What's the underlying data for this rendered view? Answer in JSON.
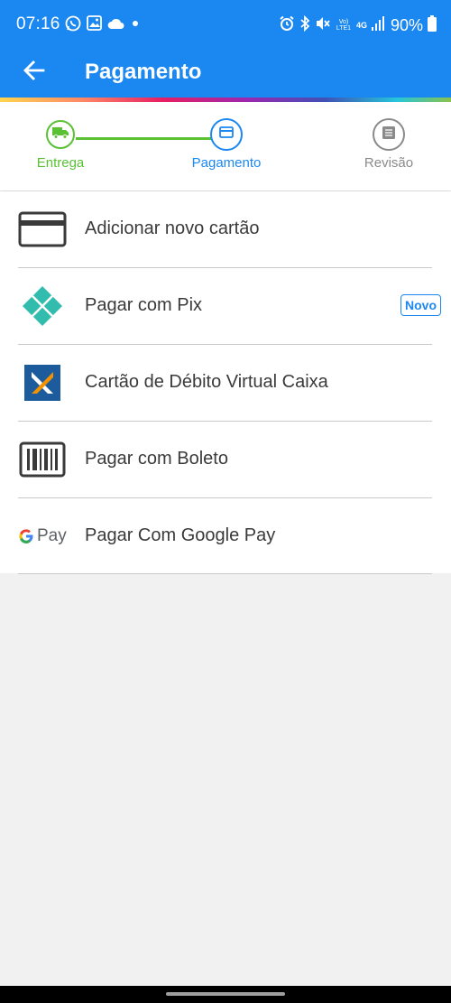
{
  "status_bar": {
    "time": "07:16",
    "battery": "90%",
    "network": "4G",
    "volte": "Vo) LTE1",
    "icons_left": [
      "whatsapp-icon",
      "gallery-icon",
      "cloud-icon",
      "dot-icon"
    ],
    "icons_right": [
      "alarm-icon",
      "bluetooth-icon",
      "mute-icon",
      "volte-icon",
      "network-4g-icon",
      "signal-icon",
      "battery-icon"
    ]
  },
  "header": {
    "title": "Pagamento",
    "back_icon": "arrow-left-icon"
  },
  "stepper": {
    "steps": [
      {
        "label": "Entrega",
        "icon": "truck-icon",
        "state": "completed"
      },
      {
        "label": "Pagamento",
        "icon": "card-icon",
        "state": "current"
      },
      {
        "label": "Revisão",
        "icon": "document-icon",
        "state": "pending"
      }
    ]
  },
  "payment_options": [
    {
      "label": "Adicionar novo cartão",
      "icon": "credit-card-icon"
    },
    {
      "label": "Pagar com Pix",
      "icon": "pix-logo",
      "badge": "Novo"
    },
    {
      "label": "Cartão de Débito Virtual Caixa",
      "icon": "caixa-logo"
    },
    {
      "label": "Pagar com Boleto",
      "icon": "barcode-icon"
    },
    {
      "label": "Pagar Com Google Pay",
      "icon": "google-pay-logo",
      "logo_text": "Pay"
    }
  ],
  "colors": {
    "primary": "#1b88f2",
    "completed": "#5ac135",
    "pending": "#8a8a8a",
    "text": "#3a3a3a",
    "pix": "#32bcad",
    "caixa_blue": "#1c5c9c",
    "caixa_orange": "#f39200"
  }
}
